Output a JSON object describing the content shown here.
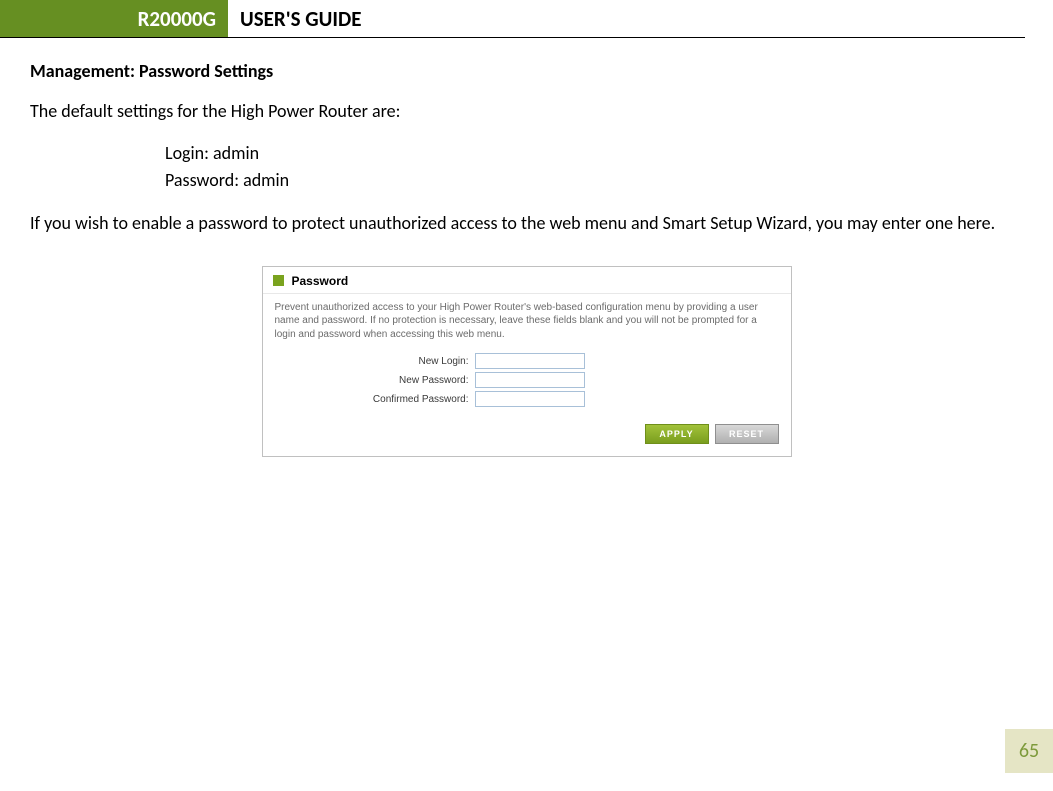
{
  "header": {
    "model": "R20000G",
    "title": "USER'S GUIDE"
  },
  "section_title": "Management: Password Settings",
  "intro": "The default settings for the High Power Router are:",
  "defaults": {
    "login": "Login: admin",
    "password": "Password: admin"
  },
  "instructions": "If you wish to enable a password to protect unauthorized access to the web menu and Smart Setup Wizard, you may enter one here.",
  "panel": {
    "title": "Password",
    "desc": "Prevent unauthorized access to your High Power Router's web-based configuration menu by providing a user name and password. If no protection is necessary, leave these fields blank and you will not be prompted for a login and password when accessing this web menu.",
    "fields": {
      "new_login": "New Login:",
      "new_password": "New Password:",
      "confirmed_password": "Confirmed Password:"
    },
    "buttons": {
      "apply": "APPLY",
      "reset": "RESET"
    }
  },
  "page_number": "65"
}
